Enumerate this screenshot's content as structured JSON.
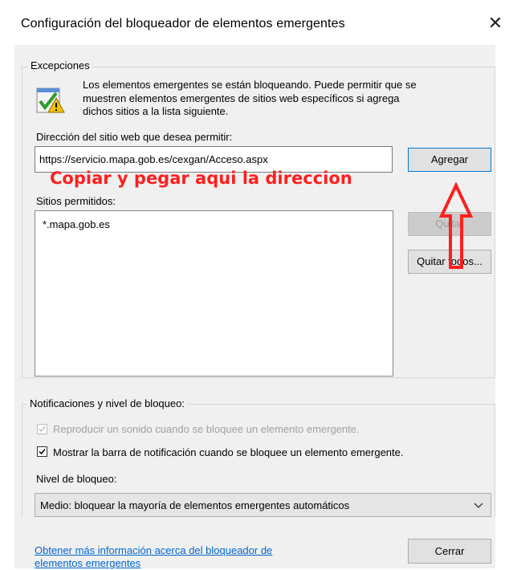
{
  "window": {
    "title": "Configuración del bloqueador de elementos emergentes",
    "close_glyph": "✕"
  },
  "exceptions": {
    "group_label": "Excepciones",
    "info_line1": "Los elementos emergentes se están bloqueando. Puede permitir que se",
    "info_line2": "muestren elementos emergentes de sitios web específicos si agrega",
    "info_line3": "dichos sitios a la lista siguiente.",
    "address_label": "Dirección del sitio web que desea permitir:",
    "address_value": "https://servicio.mapa.gob.es/cexgan/Acceso.aspx",
    "add_button": "Agregar",
    "annotation": "Copiar y pegar aqui la direccion",
    "allowed_label": "Sitios permitidos:",
    "allowed_sites": [
      "*.mapa.gob.es"
    ],
    "remove_button": "Quitar",
    "remove_all_button": "Quitar todos..."
  },
  "notifications": {
    "group_label": "Notificaciones y nivel de bloqueo:",
    "play_sound_label": "Reproducir un sonido cuando se bloquee un elemento emergente.",
    "play_sound_checked": true,
    "play_sound_enabled": false,
    "show_bar_label": "Mostrar la barra de notificación cuando se bloquee un elemento emergente.",
    "show_bar_checked": true,
    "level_label": "Nivel de bloqueo:",
    "level_value": "Medio: bloquear la mayoría de elementos emergentes automáticos"
  },
  "footer": {
    "more_info_line1": "Obtener más información acerca del bloqueador de",
    "more_info_line2": "elementos emergentes",
    "close_button": "Cerrar"
  },
  "colors": {
    "annotation_red": "#ff1f1f",
    "link_blue": "#0066cc",
    "dialog_bg": "#f0f0f0"
  },
  "icons": {
    "shield": "shield-check-warning-icon",
    "up_arrow": "annotation-up-arrow-icon",
    "dropdown": "chevron-down-icon"
  }
}
